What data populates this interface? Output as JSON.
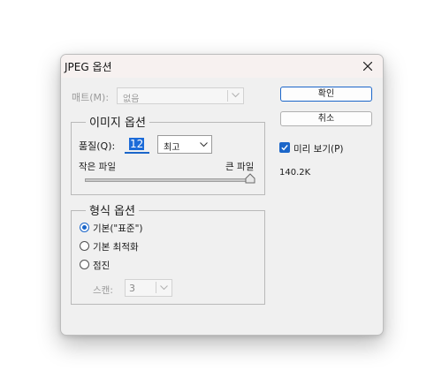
{
  "window": {
    "title": "JPEG 옵션"
  },
  "matte": {
    "label": "매트(M):",
    "value": "없음"
  },
  "image_options": {
    "legend": "이미지 옵션",
    "quality_label": "품질(Q):",
    "quality_value": "12",
    "quality_preset": "최고",
    "small_file_label": "작은 파일",
    "large_file_label": "큰 파일",
    "quality_slider_fraction": 1.0
  },
  "format_options": {
    "legend": "형식 옵션",
    "options": [
      {
        "label": "기본(\"표준\")",
        "selected": true
      },
      {
        "label": "기본 최적화",
        "selected": false
      },
      {
        "label": "점진",
        "selected": false
      }
    ],
    "scan_label": "스캔:",
    "scan_value": "3"
  },
  "buttons": {
    "ok": "확인",
    "cancel": "취소"
  },
  "preview": {
    "label": "미리 보기(P)",
    "checked": true,
    "file_size": "140.2K"
  },
  "icons": {
    "close": "close-icon",
    "chevron": "chevron-down-icon",
    "check": "checkmark-icon",
    "slider": "slider-thumb-icon"
  },
  "colors": {
    "accent": "#1b66c9",
    "dialog_bg": "#f0f0f0",
    "title_bg": "#f7f1f0"
  }
}
